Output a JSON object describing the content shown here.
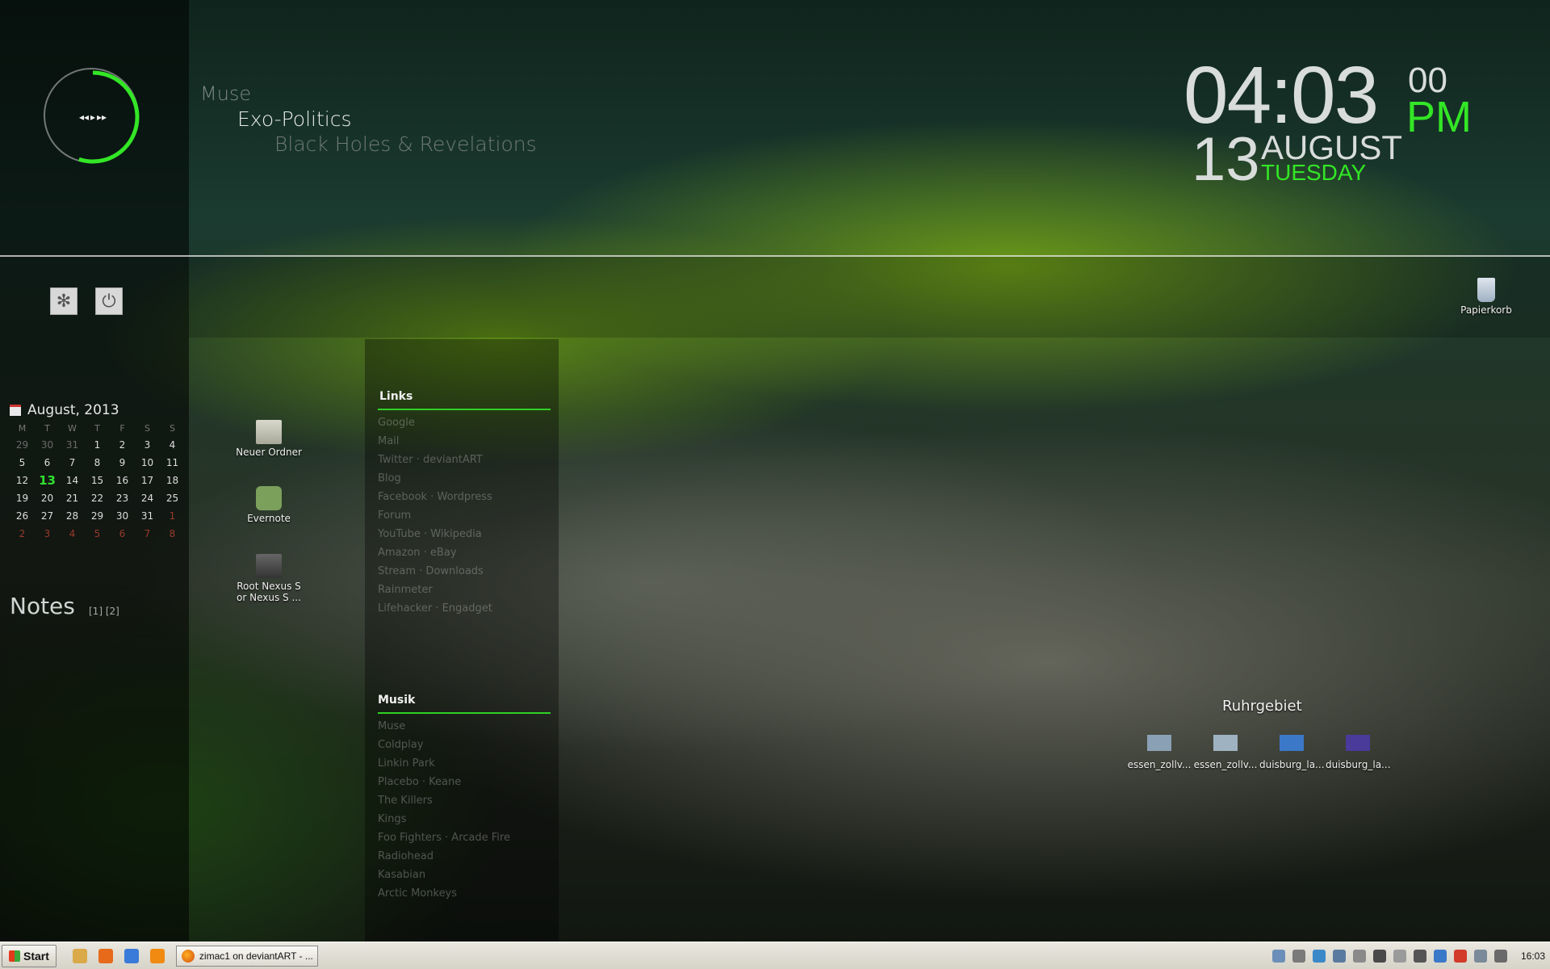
{
  "colors": {
    "accent_green": "#33e626",
    "panel_rule": "#2fd126"
  },
  "media": {
    "artist": "Muse",
    "song": "Exo-Politics",
    "album": "Black Holes & Revelations",
    "controls": [
      "prev-icon",
      "play-pause-icon",
      "next-icon"
    ],
    "progress": 0.55
  },
  "clock": {
    "time": "04:03",
    "seconds": "00",
    "ampm": "PM",
    "day": "13",
    "month": "AUGUST",
    "weekday": "TUESDAY"
  },
  "utility_buttons": [
    "settings-icon",
    "power-icon"
  ],
  "calendar": {
    "title": "August, 2013",
    "dow": [
      "M",
      "T",
      "W",
      "T",
      "F",
      "S",
      "S"
    ],
    "days": [
      [
        "29",
        "30",
        "31",
        "1",
        "2",
        "3",
        "4"
      ],
      [
        "5",
        "6",
        "7",
        "8",
        "9",
        "10",
        "11"
      ],
      [
        "12",
        "13",
        "14",
        "15",
        "16",
        "17",
        "18"
      ],
      [
        "19",
        "20",
        "21",
        "22",
        "23",
        "24",
        "25"
      ],
      [
        "26",
        "27",
        "28",
        "29",
        "30",
        "31",
        "1"
      ],
      [
        "2",
        "3",
        "4",
        "5",
        "6",
        "7",
        "8"
      ]
    ],
    "today": "13"
  },
  "notes": {
    "title": "Notes",
    "tabs": "[1] [2]"
  },
  "desktop_icons": [
    {
      "label": "Neuer Ordner",
      "icon": "folder-icon"
    },
    {
      "label": "Evernote",
      "icon": "evernote-icon"
    },
    {
      "label": "Root Nexus S or Nexus S ...",
      "icon": "shortcut-icon"
    },
    {
      "label": "Papierkorb",
      "icon": "recycle-bin-icon"
    }
  ],
  "links_panel": {
    "title": "Links",
    "items": [
      "Google",
      "Mail",
      "Twitter · deviantART",
      "Blog",
      "Facebook · Wordpress",
      "Forum",
      "YouTube · Wikipedia",
      "Amazon · eBay",
      "Stream · Downloads",
      "Rainmeter",
      "Lifehacker · Engadget"
    ]
  },
  "musik_panel": {
    "title": "Musik",
    "items": [
      "Muse",
      "Coldplay",
      "Linkin Park",
      "Placebo · Keane",
      "The Killers",
      "Kings",
      "Foo Fighters · Arcade Fire",
      "Radiohead",
      "Kasabian",
      "Arctic Monkeys"
    ]
  },
  "ruhrgebiet": {
    "title": "Ruhrgebiet",
    "items": [
      {
        "label": "essen_zollv...",
        "color": "#8aa0b4"
      },
      {
        "label": "essen_zollv...",
        "color": "#9fb2c2"
      },
      {
        "label": "duisburg_la...",
        "color": "#3b78c8"
      },
      {
        "label": "duisburg_la...",
        "color": "#4a3a9a"
      }
    ]
  },
  "taskbar": {
    "start_label": "Start",
    "quicklaunch": [
      {
        "icon": "explorer-icon",
        "color": "#d9a94a"
      },
      {
        "icon": "media-icon",
        "color": "#e66a1a"
      },
      {
        "icon": "chrome-icon",
        "color": "#3a7ad8"
      },
      {
        "icon": "vlc-icon",
        "color": "#f08a10"
      }
    ],
    "task": {
      "label": "zimac1 on deviantART - ...",
      "icon": "firefox-icon"
    },
    "tray_icons": [
      "tray-icon-1",
      "tray-icon-2",
      "tray-icon-3",
      "tray-icon-4",
      "tray-icon-5",
      "tray-icon-6",
      "tray-icon-7",
      "tray-icon-8",
      "tray-icon-9",
      "tray-icon-10",
      "tray-icon-11",
      "tray-icon-12"
    ],
    "time": "16:03"
  }
}
